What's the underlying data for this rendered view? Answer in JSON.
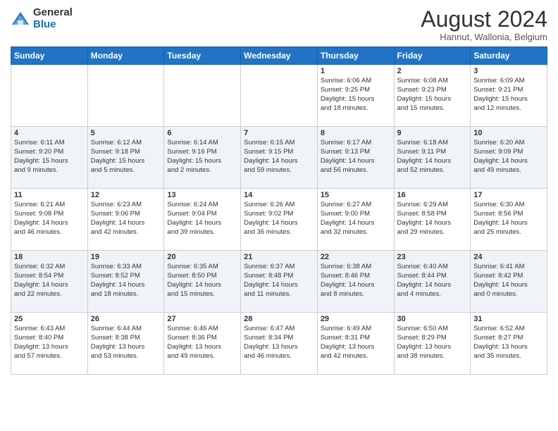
{
  "header": {
    "logo_general": "General",
    "logo_blue": "Blue",
    "month_title": "August 2024",
    "location": "Hannut, Wallonia, Belgium"
  },
  "days_of_week": [
    "Sunday",
    "Monday",
    "Tuesday",
    "Wednesday",
    "Thursday",
    "Friday",
    "Saturday"
  ],
  "weeks": [
    [
      {
        "day": "",
        "info": ""
      },
      {
        "day": "",
        "info": ""
      },
      {
        "day": "",
        "info": ""
      },
      {
        "day": "",
        "info": ""
      },
      {
        "day": "1",
        "info": "Sunrise: 6:06 AM\nSunset: 9:25 PM\nDaylight: 15 hours\nand 18 minutes."
      },
      {
        "day": "2",
        "info": "Sunrise: 6:08 AM\nSunset: 9:23 PM\nDaylight: 15 hours\nand 15 minutes."
      },
      {
        "day": "3",
        "info": "Sunrise: 6:09 AM\nSunset: 9:21 PM\nDaylight: 15 hours\nand 12 minutes."
      }
    ],
    [
      {
        "day": "4",
        "info": "Sunrise: 6:11 AM\nSunset: 9:20 PM\nDaylight: 15 hours\nand 9 minutes."
      },
      {
        "day": "5",
        "info": "Sunrise: 6:12 AM\nSunset: 9:18 PM\nDaylight: 15 hours\nand 5 minutes."
      },
      {
        "day": "6",
        "info": "Sunrise: 6:14 AM\nSunset: 9:16 PM\nDaylight: 15 hours\nand 2 minutes."
      },
      {
        "day": "7",
        "info": "Sunrise: 6:15 AM\nSunset: 9:15 PM\nDaylight: 14 hours\nand 59 minutes."
      },
      {
        "day": "8",
        "info": "Sunrise: 6:17 AM\nSunset: 9:13 PM\nDaylight: 14 hours\nand 56 minutes."
      },
      {
        "day": "9",
        "info": "Sunrise: 6:18 AM\nSunset: 9:11 PM\nDaylight: 14 hours\nand 52 minutes."
      },
      {
        "day": "10",
        "info": "Sunrise: 6:20 AM\nSunset: 9:09 PM\nDaylight: 14 hours\nand 49 minutes."
      }
    ],
    [
      {
        "day": "11",
        "info": "Sunrise: 6:21 AM\nSunset: 9:08 PM\nDaylight: 14 hours\nand 46 minutes."
      },
      {
        "day": "12",
        "info": "Sunrise: 6:23 AM\nSunset: 9:06 PM\nDaylight: 14 hours\nand 42 minutes."
      },
      {
        "day": "13",
        "info": "Sunrise: 6:24 AM\nSunset: 9:04 PM\nDaylight: 14 hours\nand 39 minutes."
      },
      {
        "day": "14",
        "info": "Sunrise: 6:26 AM\nSunset: 9:02 PM\nDaylight: 14 hours\nand 36 minutes."
      },
      {
        "day": "15",
        "info": "Sunrise: 6:27 AM\nSunset: 9:00 PM\nDaylight: 14 hours\nand 32 minutes."
      },
      {
        "day": "16",
        "info": "Sunrise: 6:29 AM\nSunset: 8:58 PM\nDaylight: 14 hours\nand 29 minutes."
      },
      {
        "day": "17",
        "info": "Sunrise: 6:30 AM\nSunset: 8:56 PM\nDaylight: 14 hours\nand 25 minutes."
      }
    ],
    [
      {
        "day": "18",
        "info": "Sunrise: 6:32 AM\nSunset: 8:54 PM\nDaylight: 14 hours\nand 22 minutes."
      },
      {
        "day": "19",
        "info": "Sunrise: 6:33 AM\nSunset: 8:52 PM\nDaylight: 14 hours\nand 18 minutes."
      },
      {
        "day": "20",
        "info": "Sunrise: 6:35 AM\nSunset: 8:50 PM\nDaylight: 14 hours\nand 15 minutes."
      },
      {
        "day": "21",
        "info": "Sunrise: 6:37 AM\nSunset: 8:48 PM\nDaylight: 14 hours\nand 11 minutes."
      },
      {
        "day": "22",
        "info": "Sunrise: 6:38 AM\nSunset: 8:46 PM\nDaylight: 14 hours\nand 8 minutes."
      },
      {
        "day": "23",
        "info": "Sunrise: 6:40 AM\nSunset: 8:44 PM\nDaylight: 14 hours\nand 4 minutes."
      },
      {
        "day": "24",
        "info": "Sunrise: 6:41 AM\nSunset: 8:42 PM\nDaylight: 14 hours\nand 0 minutes."
      }
    ],
    [
      {
        "day": "25",
        "info": "Sunrise: 6:43 AM\nSunset: 8:40 PM\nDaylight: 13 hours\nand 57 minutes."
      },
      {
        "day": "26",
        "info": "Sunrise: 6:44 AM\nSunset: 8:38 PM\nDaylight: 13 hours\nand 53 minutes."
      },
      {
        "day": "27",
        "info": "Sunrise: 6:46 AM\nSunset: 8:36 PM\nDaylight: 13 hours\nand 49 minutes."
      },
      {
        "day": "28",
        "info": "Sunrise: 6:47 AM\nSunset: 8:34 PM\nDaylight: 13 hours\nand 46 minutes."
      },
      {
        "day": "29",
        "info": "Sunrise: 6:49 AM\nSunset: 8:31 PM\nDaylight: 13 hours\nand 42 minutes."
      },
      {
        "day": "30",
        "info": "Sunrise: 6:50 AM\nSunset: 8:29 PM\nDaylight: 13 hours\nand 38 minutes."
      },
      {
        "day": "31",
        "info": "Sunrise: 6:52 AM\nSunset: 8:27 PM\nDaylight: 13 hours\nand 35 minutes."
      }
    ]
  ]
}
